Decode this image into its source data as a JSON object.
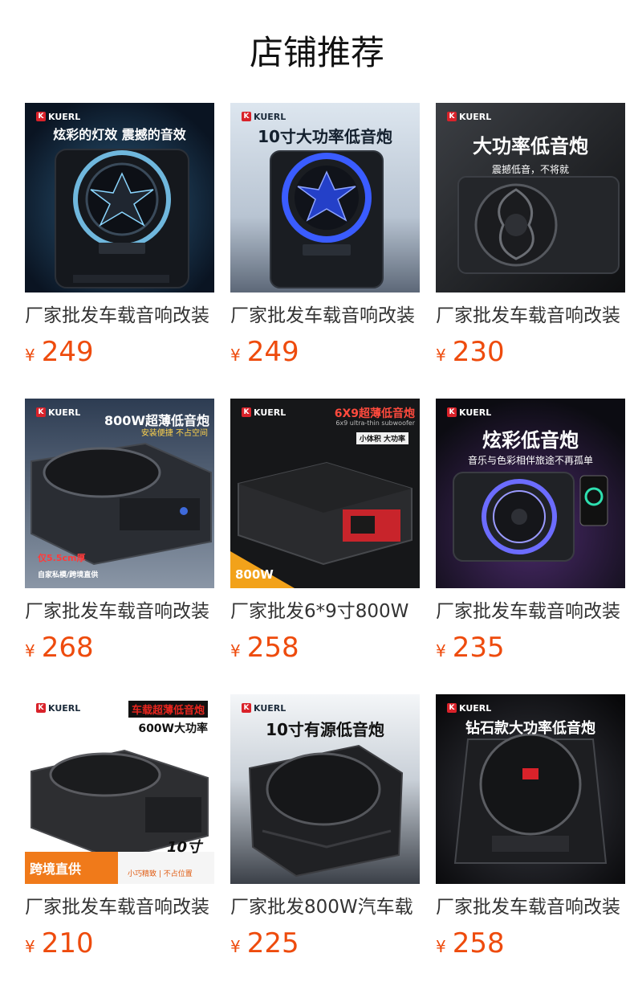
{
  "page": {
    "title": "店铺推荐"
  },
  "colors": {
    "price": "#ee4b0d",
    "title": "#111111",
    "name": "#333333"
  },
  "products": [
    {
      "name": "厂家批发车载音响改装",
      "currency": "¥",
      "price": "249",
      "image": {
        "brand": "KUERL",
        "headline": "炫彩的灯效 震撼的音效",
        "subline": "",
        "tags": []
      }
    },
    {
      "name": "厂家批发车载音响改装",
      "currency": "¥",
      "price": "249",
      "image": {
        "brand": "KUERL",
        "headline": "10寸大功率低音炮",
        "subline": "",
        "tags": []
      }
    },
    {
      "name": "厂家批发车载音响改装",
      "currency": "¥",
      "price": "230",
      "image": {
        "brand": "KUERL",
        "headline": "大功率低音炮",
        "subline": "震撼低音，不将就",
        "tags": []
      }
    },
    {
      "name": "厂家批发车载音响改装",
      "currency": "¥",
      "price": "268",
      "image": {
        "brand": "KUERL",
        "headline": "800W超薄低音炮",
        "subline": "安装便捷 不占空间",
        "tags": [
          "仅5.5cm厚",
          "自家私模/跨境直供"
        ]
      }
    },
    {
      "name": "厂家批发6*9寸800W",
      "currency": "¥",
      "price": "258",
      "image": {
        "brand": "KUERL",
        "headline": "6X9超薄低音炮",
        "subline": "6x9 ultra-thin subwoofer",
        "tags": [
          "小体积 大功率",
          "800W"
        ]
      }
    },
    {
      "name": "厂家批发车载音响改装",
      "currency": "¥",
      "price": "235",
      "image": {
        "brand": "KUERL",
        "headline": "炫彩低音炮",
        "subline": "音乐与色彩相伴旅途不再孤单",
        "tags": []
      }
    },
    {
      "name": "厂家批发车载音响改装",
      "currency": "¥",
      "price": "210",
      "image": {
        "brand": "KUERL",
        "headline": "车载超薄低音炮",
        "subline": "600W大功率",
        "tags": [
          "10寸",
          "跨境直供",
          "小巧精致 | 不占位置"
        ]
      }
    },
    {
      "name": "厂家批发800W汽车载",
      "currency": "¥",
      "price": "225",
      "image": {
        "brand": "KUERL",
        "headline": "10寸有源低音炮",
        "subline": "",
        "tags": []
      }
    },
    {
      "name": "厂家批发车载音响改装",
      "currency": "¥",
      "price": "258",
      "image": {
        "brand": "KUERL",
        "headline": "钻石款大功率低音炮",
        "subline": "",
        "tags": []
      }
    }
  ]
}
